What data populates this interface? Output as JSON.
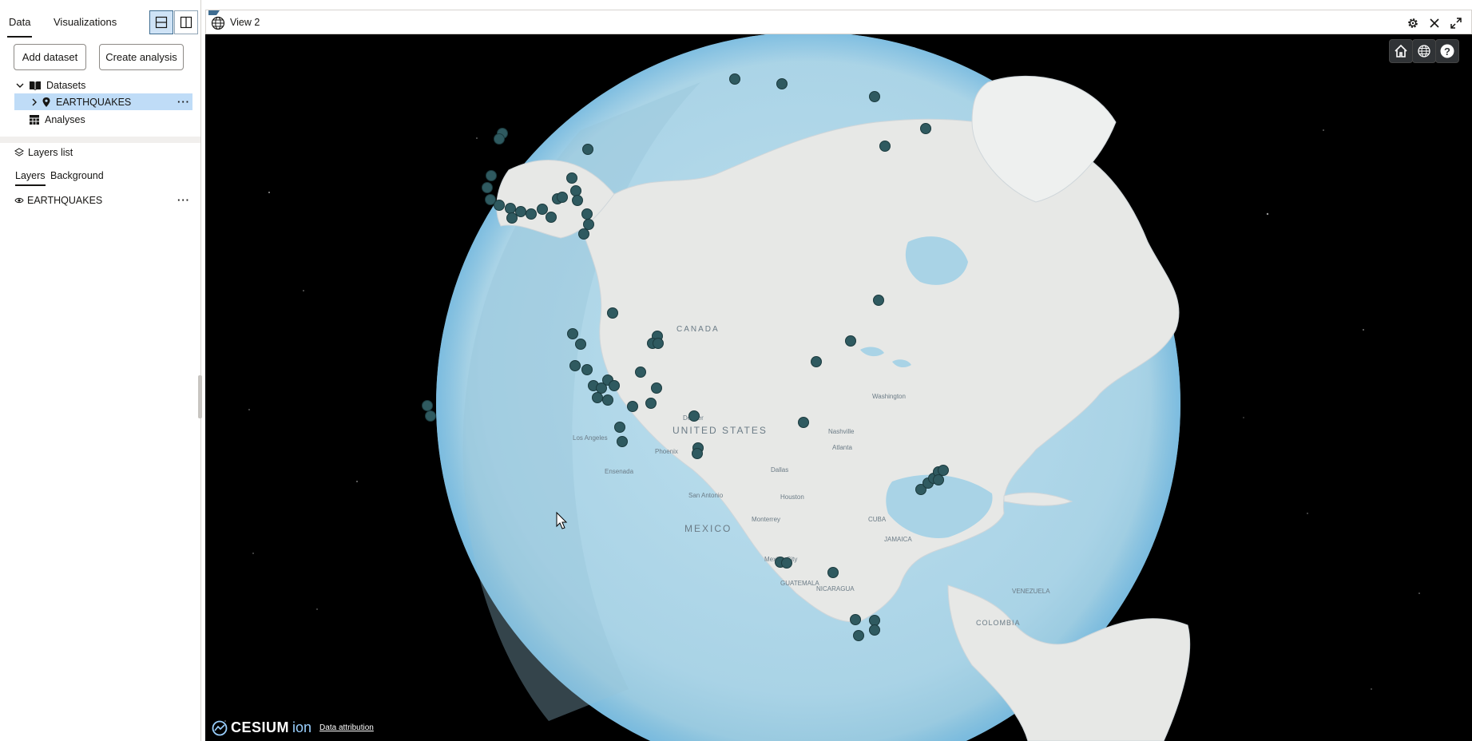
{
  "left_panel": {
    "tabs": [
      {
        "label": "Data",
        "active": true
      },
      {
        "label": "Visualizations",
        "active": false
      }
    ],
    "actions": {
      "add_dataset": "Add dataset",
      "create_analysis": "Create analysis"
    },
    "tree": {
      "datasets_label": "Datasets",
      "dataset_item": "EARTHQUAKES",
      "analyses_label": "Analyses"
    },
    "layers": {
      "header": "Layers list",
      "tabs": [
        {
          "label": "Layers",
          "active": true
        },
        {
          "label": "Background",
          "active": false
        }
      ],
      "items": [
        {
          "label": "EARTHQUAKES",
          "visible": true
        }
      ]
    }
  },
  "view": {
    "title": "View 2",
    "header_icons": [
      "globe-icon",
      "gear-icon",
      "close-icon",
      "expand-icon"
    ],
    "nav_buttons": [
      "home-icon",
      "globe-icon",
      "help-icon"
    ],
    "credit": {
      "brand": "CESIUM",
      "brand_suffix": "ion",
      "attribution": "Data attribution"
    }
  },
  "map_labels": {
    "country": [
      "CANADA",
      "UNITED STATES",
      "MEXICO"
    ],
    "cities": [
      "Los Angeles",
      "Phoenix",
      "Dallas",
      "Houston",
      "San Antonio",
      "Monterrey",
      "Denver",
      "Atlanta",
      "Nashville",
      "Washington",
      "Mexico City",
      "Ensenada"
    ],
    "regions": [
      "GUATEMALA",
      "NICARAGUA",
      "COLOMBIA",
      "VENEZUELA",
      "CUBA",
      "JAMAICA"
    ]
  },
  "colors": {
    "accent": "#3f6d91",
    "selected_row": "#bfdcf7",
    "earthquake_marker": "#2f5a60",
    "ocean": "#a9d3e6",
    "land": "#e6e6e3"
  }
}
